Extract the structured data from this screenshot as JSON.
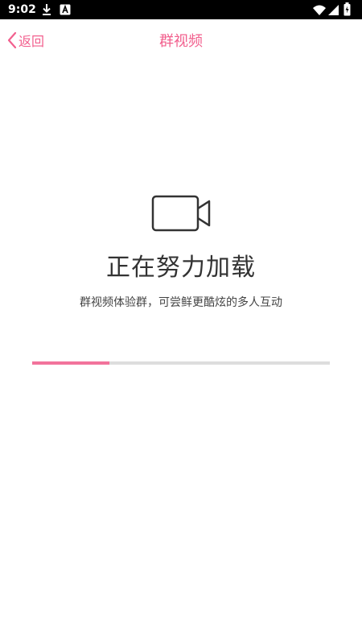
{
  "status_bar": {
    "time": "9:02",
    "icons": [
      "download-icon",
      "app-icon",
      "wifi-icon",
      "signal-icon",
      "battery-icon"
    ]
  },
  "nav": {
    "back_label": "返回",
    "title": "群视频",
    "accent_color": "#f2608e"
  },
  "loading": {
    "icon": "video-camera-icon",
    "title": "正在努力加载",
    "subtitle": "群视频体验群，可尝鲜更酷炫的多人互动",
    "progress_percent": 26,
    "progress_color": "#f2739b",
    "track_color": "#dddddd"
  }
}
